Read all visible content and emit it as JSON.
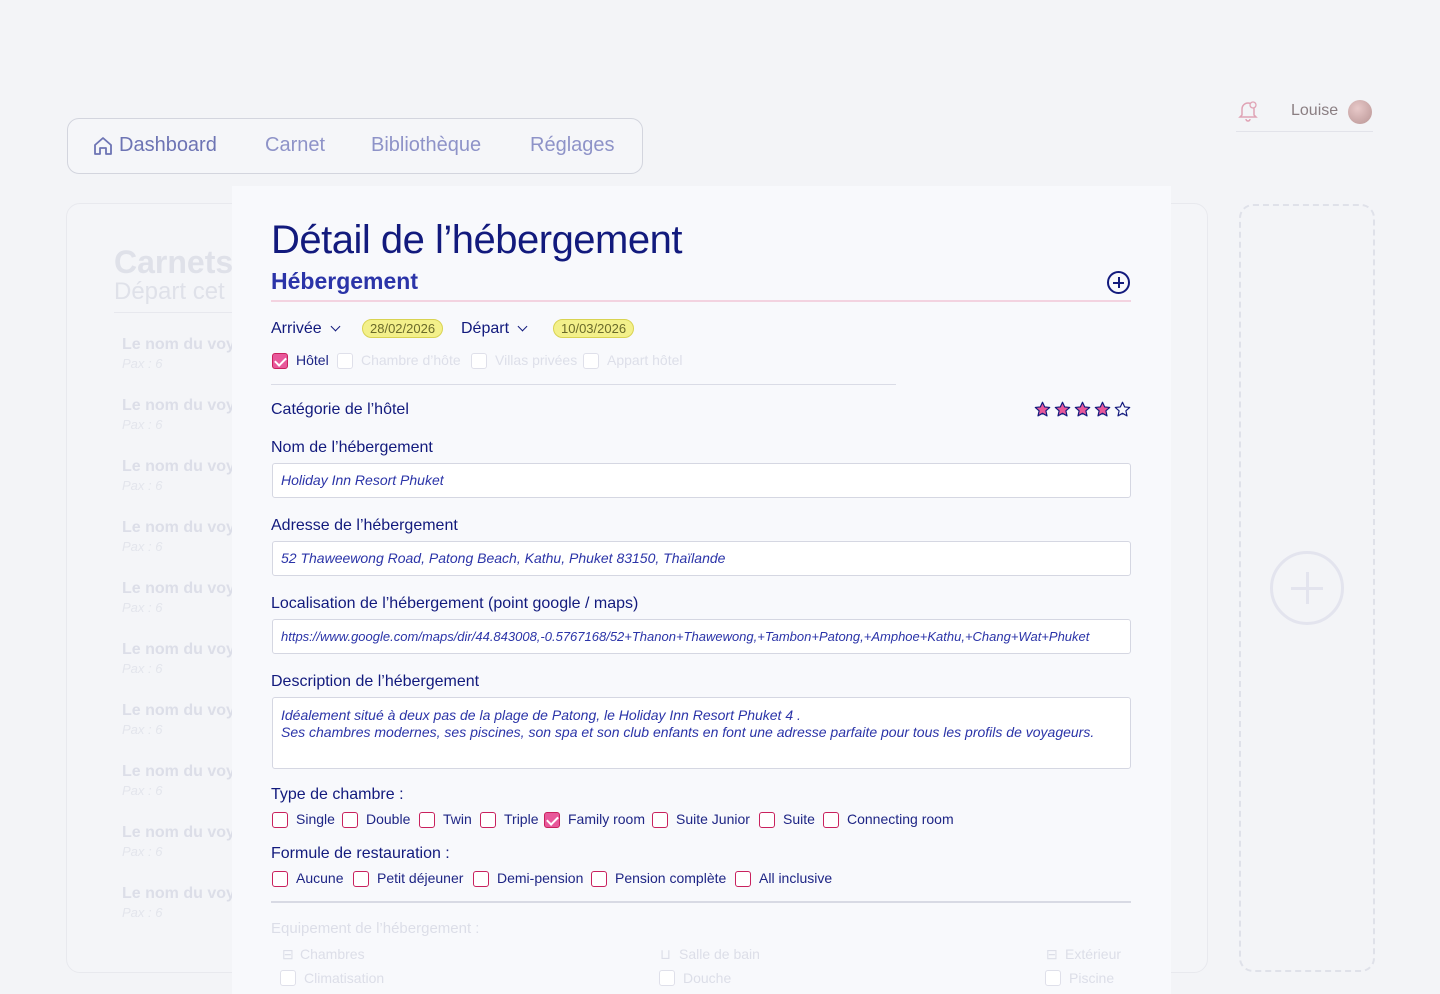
{
  "user": {
    "name": "Louise"
  },
  "nav": {
    "items": [
      "Dashboard",
      "Carnet",
      "Bibliothèque",
      "Réglages"
    ]
  },
  "background": {
    "title": "Carnets",
    "subtitle": "Départ cet",
    "items": [
      {
        "name": "Le nom du voy",
        "pax": "Pax : 6"
      },
      {
        "name": "Le nom du voy",
        "pax": "Pax : 6"
      },
      {
        "name": "Le nom du voy",
        "pax": "Pax : 6"
      },
      {
        "name": "Le nom du voy",
        "pax": "Pax : 6"
      },
      {
        "name": "Le nom du voy",
        "pax": "Pax : 6"
      },
      {
        "name": "Le nom du voy",
        "pax": "Pax : 6"
      },
      {
        "name": "Le nom du voy",
        "pax": "Pax : 6"
      },
      {
        "name": "Le nom du voy",
        "pax": "Pax : 6"
      },
      {
        "name": "Le nom du voy",
        "pax": "Pax : 6"
      },
      {
        "name": "Le nom du voy",
        "pax": "Pax : 6"
      }
    ]
  },
  "modal": {
    "title": "Détail de l’hébergement",
    "section": "Hébergement",
    "arrival": {
      "label": "Arrivée",
      "date": "28/02/2026"
    },
    "departure": {
      "label": "Départ",
      "date": "10/03/2026"
    },
    "types": [
      {
        "label": "Hôtel",
        "checked": true
      },
      {
        "label": "Chambre d’hôte",
        "checked": false
      },
      {
        "label": "Villas privées",
        "checked": false
      },
      {
        "label": "Appart hôtel",
        "checked": false
      }
    ],
    "category_label": "Catégorie de l’hôtel",
    "category_rating": 4,
    "category_max": 5,
    "name_label": "Nom de l’hébergement",
    "name_value": "Holiday Inn Resort Phuket",
    "address_label": "Adresse de l’hébergement",
    "address_value": "52 Thaweewong Road, Patong Beach, Kathu, Phuket 83150, Thaïlande",
    "location_label": "Localisation de l’hébergement (point google / maps)",
    "location_value": "https://www.google.com/maps/dir/44.843008,-0.5767168/52+Thanon+Thawewong,+Tambon+Patong,+Amphoe+Kathu,+Chang+Wat+Phuket",
    "description_label": "Description de l’hébergement",
    "description_line1": "Idéalement situé à deux pas de la plage de Patong, le Holiday Inn Resort Phuket 4 .",
    "description_line2": "Ses chambres modernes, ses piscines, son spa et son club enfants en font une adresse parfaite pour tous les profils de voyageurs.",
    "room_type_label": "Type de chambre :",
    "room_types": [
      {
        "label": "Single",
        "checked": false
      },
      {
        "label": "Double",
        "checked": false
      },
      {
        "label": "Twin",
        "checked": false
      },
      {
        "label": "Triple",
        "checked": false
      },
      {
        "label": "Family room",
        "checked": true
      },
      {
        "label": "Suite Junior",
        "checked": false
      },
      {
        "label": "Suite",
        "checked": false
      },
      {
        "label": "Connecting room",
        "checked": false
      }
    ],
    "meal_label": "Formule de restauration :",
    "meals": [
      {
        "label": "Aucune",
        "checked": false
      },
      {
        "label": "Petit déjeuner",
        "checked": false
      },
      {
        "label": "Demi-pension",
        "checked": false
      },
      {
        "label": "Pension complète",
        "checked": false
      },
      {
        "label": "All inclusive",
        "checked": false
      }
    ],
    "equipment_label": "Equipement de l’hébergement :",
    "equipment_groups": [
      {
        "title": "Chambres",
        "first": "Climatisation"
      },
      {
        "title": "Salle de bain",
        "first": "Douche"
      },
      {
        "title": "Extérieur",
        "first": "Piscine"
      }
    ]
  },
  "colors": {
    "primary": "#121a7d",
    "accent": "#e8589a",
    "highlight": "#f3f08a"
  }
}
